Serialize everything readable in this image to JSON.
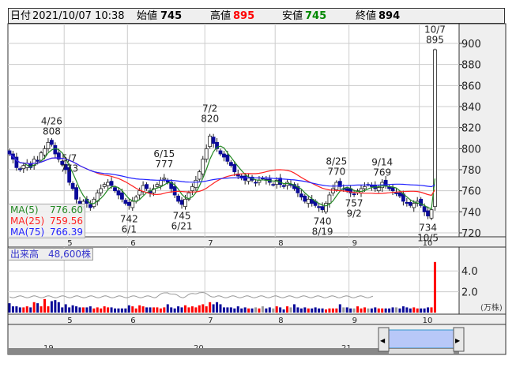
{
  "header": {
    "date_label": "日付",
    "date": "2021/10/07 10:38",
    "open_label": "始値",
    "open": "745",
    "high_label": "高値",
    "high": "895",
    "low_label": "安値",
    "low": "745",
    "close_label": "終値",
    "close": "894"
  },
  "legend": [
    {
      "name": "MA(5)",
      "value": "776.60",
      "color": "#228822"
    },
    {
      "name": "MA(25)",
      "value": "759.56",
      "color": "#ff2222"
    },
    {
      "name": "MA(75)",
      "value": "766.39",
      "color": "#2222ff"
    }
  ],
  "volume_label": "出来高　48,600株",
  "volume_unit": "(万株)",
  "nav_years": [
    "19",
    "20",
    "21"
  ],
  "chart_data": {
    "type": "candlestick",
    "price_ylim": [
      720,
      900
    ],
    "price_ticks": [
      "720",
      "740",
      "760",
      "780",
      "800",
      "820",
      "840",
      "860",
      "880",
      "900"
    ],
    "volume_ylim": [
      0,
      6
    ],
    "volume_ticks": [
      "2.0",
      "4.0"
    ],
    "months": [
      {
        "label": "5",
        "start": 16
      },
      {
        "label": "6",
        "start": 34
      },
      {
        "label": "7",
        "start": 56
      },
      {
        "label": "8",
        "start": 76
      },
      {
        "label": "9",
        "start": 97
      },
      {
        "label": "10",
        "start": 117
      }
    ],
    "closes": [
      795,
      790,
      782,
      780,
      784,
      786,
      782,
      790,
      788,
      796,
      800,
      806,
      804,
      795,
      790,
      785,
      780,
      768,
      762,
      752,
      745,
      750,
      748,
      744,
      752,
      758,
      762,
      766,
      768,
      765,
      760,
      756,
      752,
      748,
      746,
      750,
      754,
      760,
      765,
      762,
      758,
      762,
      766,
      770,
      772,
      768,
      762,
      756,
      750,
      747,
      752,
      758,
      764,
      770,
      778,
      790,
      800,
      812,
      805,
      800,
      795,
      792,
      788,
      784,
      778,
      774,
      772,
      770,
      772,
      770,
      768,
      770,
      772,
      770,
      768,
      766,
      770,
      766,
      764,
      768,
      766,
      762,
      758,
      754,
      750,
      752,
      748,
      746,
      744,
      742,
      748,
      756,
      762,
      768,
      764,
      762,
      760,
      758,
      757,
      760,
      762,
      764,
      766,
      764,
      762,
      763,
      768,
      765,
      762,
      760,
      758,
      755,
      750,
      748,
      746,
      748,
      750,
      746,
      740,
      736,
      742,
      894
    ],
    "last_open": 745,
    "last_high": 895,
    "volumes": [
      0.9,
      0.6,
      0.6,
      0.5,
      0.5,
      0.6,
      0.5,
      1.0,
      0.9,
      0.6,
      1.3,
      0.6,
      1.1,
      1.2,
      1.0,
      0.5,
      0.8,
      0.5,
      0.7,
      0.6,
      0.5,
      0.5,
      0.5,
      0.6,
      0.4,
      0.5,
      0.4,
      0.6,
      0.5,
      0.5,
      0.4,
      0.4,
      0.4,
      0.4,
      0.7,
      0.6,
      0.4,
      0.7,
      0.6,
      0.5,
      0.5,
      0.5,
      0.5,
      0.4,
      0.5,
      0.8,
      0.5,
      0.4,
      0.6,
      0.5,
      0.7,
      0.5,
      0.6,
      0.5,
      0.7,
      0.8,
      0.6,
      1.0,
      0.8,
      1.0,
      0.8,
      0.5,
      0.5,
      0.5,
      0.4,
      0.6,
      0.4,
      0.5,
      0.4,
      0.4,
      0.5,
      0.4,
      0.6,
      0.4,
      0.5,
      0.4,
      0.6,
      0.5,
      0.3,
      0.6,
      0.5,
      0.8,
      0.5,
      0.4,
      0.5,
      0.4,
      0.4,
      0.5,
      0.4,
      0.4,
      0.3,
      0.4,
      0.4,
      0.4,
      0.8,
      0.5,
      0.5,
      0.4,
      0.4,
      0.6,
      0.4,
      0.5,
      0.4,
      0.4,
      0.5,
      0.4,
      0.4,
      0.4,
      0.4,
      0.5,
      0.5,
      0.4,
      0.6,
      0.5,
      0.4,
      0.5,
      0.4,
      0.4,
      0.4,
      0.5,
      0.5,
      4.86
    ],
    "annotations": [
      {
        "idx": 12,
        "text": [
          "4/26",
          "808"
        ],
        "pos": "above",
        "price": 808
      },
      {
        "idx": 17,
        "text": [
          "5/7",
          "773"
        ],
        "pos": "above",
        "price": 773
      },
      {
        "idx": 34,
        "text": [
          "742",
          "6/1"
        ],
        "pos": "below",
        "price": 742
      },
      {
        "idx": 44,
        "text": [
          "6/15",
          "777"
        ],
        "pos": "above",
        "price": 777
      },
      {
        "idx": 49,
        "text": [
          "745",
          "6/21"
        ],
        "pos": "below",
        "price": 745
      },
      {
        "idx": 57,
        "text": [
          "7/2",
          "820"
        ],
        "pos": "above",
        "price": 820
      },
      {
        "idx": 89,
        "text": [
          "740",
          "8/19"
        ],
        "pos": "below",
        "price": 740
      },
      {
        "idx": 93,
        "text": [
          "8/25",
          "770"
        ],
        "pos": "above",
        "price": 770
      },
      {
        "idx": 98,
        "text": [
          "757",
          "9/2"
        ],
        "pos": "below",
        "price": 757
      },
      {
        "idx": 106,
        "text": [
          "9/14",
          "769"
        ],
        "pos": "above",
        "price": 769
      },
      {
        "idx": 119,
        "text": [
          "734",
          "10/5"
        ],
        "pos": "below",
        "price": 734
      },
      {
        "idx": 121,
        "text": [
          "10/7",
          "895"
        ],
        "pos": "above",
        "price": 895
      }
    ]
  }
}
